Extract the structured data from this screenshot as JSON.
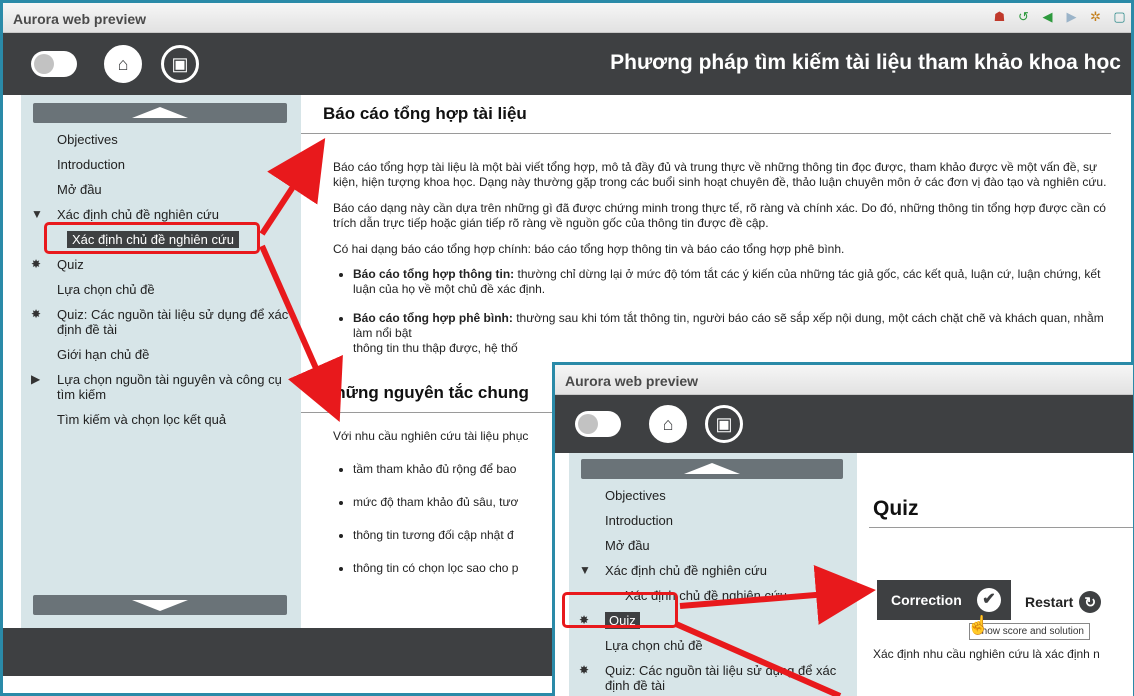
{
  "window": {
    "title": "Aurora web preview",
    "course_title": "Phương pháp tìm kiếm tài liệu tham khảo khoa học"
  },
  "toolbar_icons": [
    "home-icon",
    "sync-icon",
    "back-arrow-icon",
    "forward-arrow-icon",
    "settings-icon",
    "window-icon"
  ],
  "nav": {
    "items": [
      {
        "label": "Objectives"
      },
      {
        "label": "Introduction"
      },
      {
        "label": "Mở đầu"
      },
      {
        "label": "Xác định chủ đề nghiên cứu"
      },
      {
        "label": "Xác định chủ đề nghiên cứu"
      },
      {
        "label": "Quiz"
      },
      {
        "label": "Lựa chọn chủ đề"
      },
      {
        "label": "Quiz: Các nguồn tài liệu sử dụng để xác định đề tài"
      },
      {
        "label": "Giới hạn chủ đề"
      },
      {
        "label": "Lựa chọn nguồn tài nguyên và công cụ tìm kiếm"
      },
      {
        "label": "Tìm kiếm và chọn lọc kết quả"
      }
    ]
  },
  "main": {
    "section1_title": "Báo cáo tổng hợp tài liệu",
    "p1": "Báo cáo tổng hợp tài liệu là một bài viết tổng hợp, mô tả đầy đủ và trung thực về những thông tin đọc được, tham khảo được về một vấn đề, sự kiện, hiện tượng khoa học. Dạng này thường gặp trong các buổi sinh hoạt chuyên đề, thảo luận chuyên môn ở các đơn vị đào tạo và nghiên cứu.",
    "p2": "Báo cáo dạng này cần dựa trên những gì đã được chứng minh trong thực tế, rõ ràng và chính xác. Do đó, những thông tin tổng hợp được cần có trích dẫn trực tiếp hoặc gián tiếp rõ ràng về nguồn gốc của thông tin được đề cập.",
    "p3": "Có hai dạng báo cáo tổng hợp chính: báo cáo tổng hợp thông tin và báo cáo tổng hợp phê bình.",
    "b1_bold": "Báo cáo tổng hợp thông tin:",
    "b1_text": " thường chỉ dừng lại ở mức độ tóm tắt các ý kiến của những tác giả gốc, các kết quả, luận cứ, luận chứng, kết luận của họ về một chủ đề xác định.",
    "b2_bold": "Báo cáo tổng hợp phê bình:",
    "b2_text": " thường sau khi tóm tắt thông tin, người báo cáo sẽ sắp xếp nội dung, một cách chặt chẽ và khách quan, nhằm làm nổi bật",
    "b2_line3": "thông tin thu thập được, hệ thố",
    "section2_title": "Những nguyên tắc chung",
    "p4": "Với nhu cầu nghiên cứu tài liệu phục",
    "list2": [
      "tầm tham khảo đủ rộng để bao",
      "mức độ tham khảo đủ sâu, tươ",
      "thông tin tương đối cập nhật đ",
      "thông tin có chọn lọc sao cho p"
    ]
  },
  "window2": {
    "title": "Aurora web preview",
    "nav_items": [
      {
        "label": "Objectives"
      },
      {
        "label": "Introduction"
      },
      {
        "label": "Mở đầu"
      },
      {
        "label": "Xác định chủ đề nghiên cứu"
      },
      {
        "label": "Xác định chủ đề nghiên cứu"
      },
      {
        "label": "Quiz"
      },
      {
        "label": "Lựa chọn chủ đề"
      },
      {
        "label": "Quiz: Các nguồn tài liệu sử dụng để xác định đề tài"
      }
    ],
    "quiz_title": "Quiz",
    "correction_label": "Correction",
    "restart_label": "Restart",
    "tooltip": "Show score and solution",
    "question": "Xác định nhu cầu nghiên cứu là xác định n"
  },
  "colors": {
    "header": "#3e4042",
    "sidebar": "#d7e5e8",
    "highlight": "#e8191c",
    "window_border": "#2a8aa8"
  }
}
